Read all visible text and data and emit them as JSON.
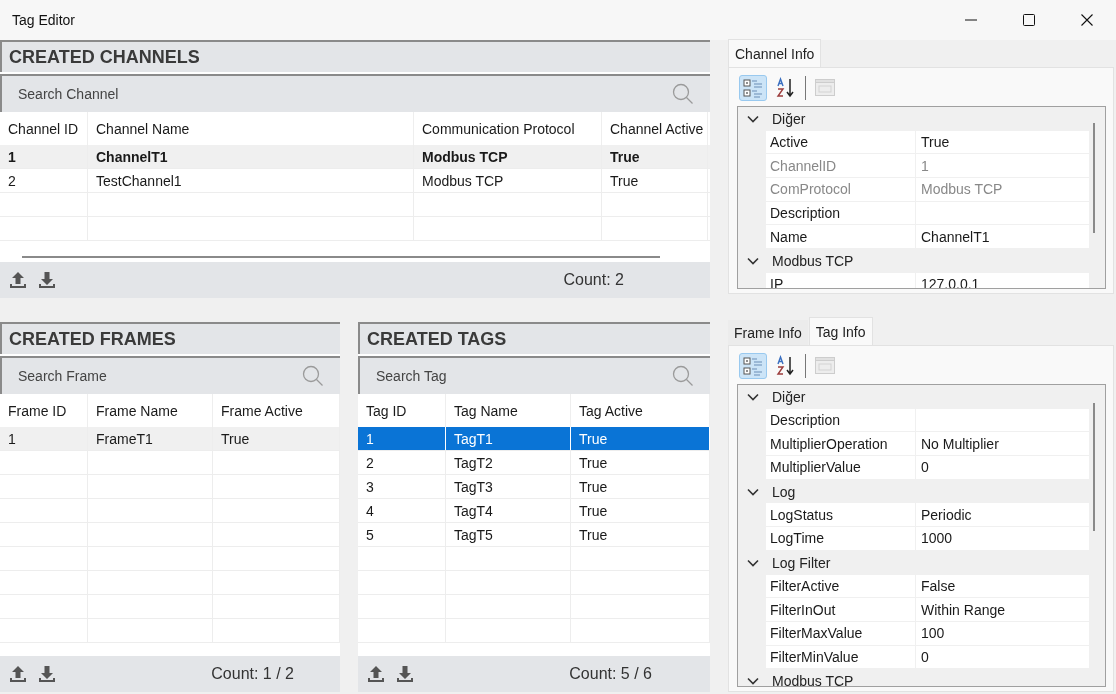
{
  "window": {
    "title": "Tag Editor"
  },
  "channels": {
    "title": "CREATED CHANNELS",
    "search": {
      "placeholder": "Search Channel"
    },
    "columns": [
      "Channel ID",
      "Channel Name",
      "Communication Protocol",
      "Channel Active"
    ],
    "rows": [
      {
        "cells": [
          "1",
          "ChannelT1",
          "Modbus TCP",
          "True"
        ],
        "selected": false,
        "current": true,
        "bold": true
      },
      {
        "cells": [
          "2",
          "TestChannel1",
          "Modbus TCP",
          "True"
        ],
        "selected": false,
        "current": false,
        "bold": false
      }
    ],
    "count": "Count: 2"
  },
  "frames": {
    "title": "CREATED FRAMES",
    "search": {
      "placeholder": "Search Frame"
    },
    "columns": [
      "Frame ID",
      "Frame Name",
      "Frame Active"
    ],
    "rows": [
      {
        "cells": [
          "1",
          "FrameT1",
          "True"
        ],
        "selected": false,
        "current": true,
        "bold": false
      }
    ],
    "count": "Count: 1 / 2"
  },
  "tags": {
    "title": "CREATED TAGS",
    "search": {
      "placeholder": "Search Tag"
    },
    "columns": [
      "Tag ID",
      "Tag Name",
      "Tag Active"
    ],
    "rows": [
      {
        "cells": [
          "1",
          "TagT1",
          "True"
        ],
        "selected": true,
        "bold": false
      },
      {
        "cells": [
          "2",
          "TagT2",
          "True"
        ],
        "selected": false,
        "bold": false
      },
      {
        "cells": [
          "3",
          "TagT3",
          "True"
        ],
        "selected": false,
        "bold": false
      },
      {
        "cells": [
          "4",
          "TagT4",
          "True"
        ],
        "selected": false,
        "bold": false
      },
      {
        "cells": [
          "5",
          "TagT5",
          "True"
        ],
        "selected": false,
        "bold": false
      }
    ],
    "count": "Count: 5 / 6"
  },
  "channel_info": {
    "tabs": [
      {
        "label": "Channel Info",
        "selected": true
      }
    ],
    "toolbar": [
      {
        "kind": "categorized",
        "selected": true,
        "disabled": false
      },
      {
        "kind": "alphabetical",
        "selected": false,
        "disabled": false
      },
      {
        "kind": "pages",
        "selected": false,
        "disabled": true
      }
    ],
    "groups": [
      {
        "name": "Diğer",
        "expanded": true,
        "properties": [
          {
            "name": "Active",
            "value": "True",
            "readonly": false
          },
          {
            "name": "ChannelID",
            "value": "1",
            "readonly": true
          },
          {
            "name": "ComProtocol",
            "value": "Modbus TCP",
            "readonly": true
          },
          {
            "name": "Description",
            "readonly": false
          },
          {
            "name": "Name",
            "value": "ChannelT1",
            "readonly": false
          }
        ]
      },
      {
        "name": "Modbus TCP",
        "expanded": true,
        "properties": [
          {
            "name": "IP",
            "value": "127.0.0.1",
            "readonly": false
          }
        ]
      }
    ]
  },
  "tag_info": {
    "tabs": [
      {
        "label": "Frame Info",
        "selected": false
      },
      {
        "label": "Tag Info",
        "selected": true
      }
    ],
    "toolbar": [
      {
        "kind": "categorized",
        "selected": true,
        "disabled": false
      },
      {
        "kind": "alphabetical",
        "selected": false,
        "disabled": false
      },
      {
        "kind": "pages",
        "selected": false,
        "disabled": true
      }
    ],
    "groups": [
      {
        "name": "Diğer",
        "expanded": true,
        "properties": [
          {
            "name": "Description",
            "readonly": false
          },
          {
            "name": "MultiplierOperation",
            "value": "No Multiplier",
            "readonly": false
          },
          {
            "name": "MultiplierValue",
            "value": "0",
            "readonly": false
          }
        ]
      },
      {
        "name": "Log",
        "expanded": true,
        "properties": [
          {
            "name": "LogStatus",
            "value": "Periodic",
            "readonly": false
          },
          {
            "name": "LogTime",
            "value": "1000",
            "readonly": false
          }
        ]
      },
      {
        "name": "Log Filter",
        "expanded": true,
        "properties": [
          {
            "name": "FilterActive",
            "value": "False",
            "readonly": false
          },
          {
            "name": "FilterInOut",
            "value": "Within Range",
            "readonly": false
          },
          {
            "name": "FilterMaxValue",
            "value": "100",
            "readonly": false
          },
          {
            "name": "FilterMinValue",
            "value": "0",
            "readonly": false
          }
        ]
      },
      {
        "name": "Modbus TCP",
        "expanded": true
      }
    ]
  }
}
